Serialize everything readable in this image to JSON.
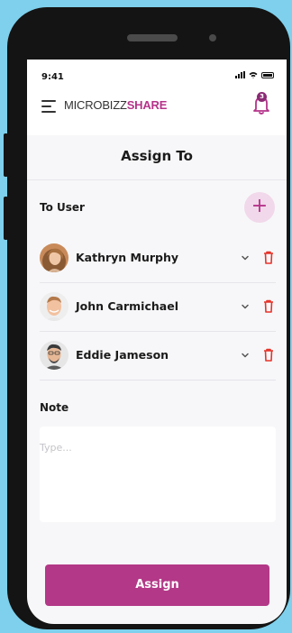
{
  "status_bar": {
    "time": "9:41"
  },
  "app_bar": {
    "logo_part1": "MICROBIZZ",
    "logo_part2": "SHARE",
    "notification_count": "3"
  },
  "page": {
    "title": "Assign To"
  },
  "to_user": {
    "label": "To User",
    "add_symbol": "+",
    "users": [
      {
        "name": "Kathryn Murphy"
      },
      {
        "name": "John Carmichael"
      },
      {
        "name": "Eddie Jameson"
      }
    ]
  },
  "note": {
    "label": "Note",
    "placeholder": "Type..."
  },
  "actions": {
    "assign_label": "Assign"
  },
  "colors": {
    "accent": "#b33887",
    "accent_light": "#f1d8ea",
    "delete": "#e5342b",
    "background": "#7ed0ec"
  }
}
